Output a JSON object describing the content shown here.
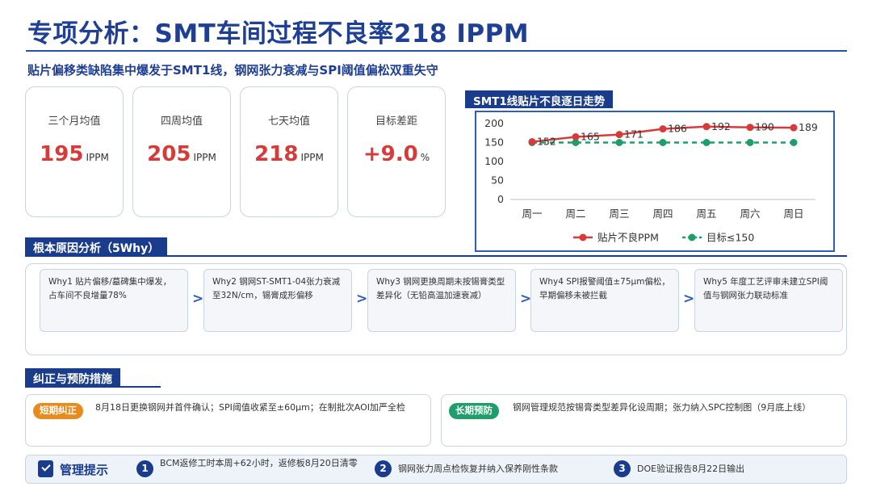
{
  "title": "专项分析：SMT车间过程不良率218 IPPM",
  "subtitle": "贴片偏移类缺陷集中爆发于SMT1线，钢网张力衰减与SPI阈值偏松双重失守",
  "kpis": [
    {
      "label": "三个月均值",
      "value": "195",
      "unit": "IPPM"
    },
    {
      "label": "四周均值",
      "value": "205",
      "unit": "IPPM"
    },
    {
      "label": "七天均值",
      "value": "218",
      "unit": "IPPM"
    },
    {
      "label": "目标差距",
      "value": "+9.0",
      "unit": "%"
    }
  ],
  "chart_tag": "SMT1线贴片不良逐日走势",
  "chart_data": {
    "type": "line",
    "categories": [
      "周一",
      "周二",
      "周三",
      "周四",
      "周五",
      "周六",
      "周日"
    ],
    "series": [
      {
        "name": "贴片不良PPM",
        "values": [
          152,
          165,
          171,
          186,
          192,
          190,
          189
        ],
        "color": "#d83a3a"
      },
      {
        "name": "目标≤150",
        "values": [
          150,
          150,
          150,
          150,
          150,
          150,
          150
        ],
        "color": "#1e9e6b",
        "dashed": true
      }
    ],
    "ylim": [
      0,
      200
    ],
    "yticks": [
      0,
      50,
      100,
      150,
      200
    ],
    "legend": "bottom",
    "grid": false
  },
  "why": {
    "tag": "根本原因分析（5Why）",
    "arrow": ">",
    "items": [
      "Why1 贴片偏移/墓碑集中爆发，占车间不良增量78%",
      "Why2 钢网ST-SMT1-04张力衰减至32N/cm，锡膏成形偏移",
      "Why3 钢网更换周期未按锡膏类型差异化（无铅高温加速衰减）",
      "Why4 SPI报警阈值±75μm偏松，早期偏移未被拦截",
      "Why5 年度工艺评审未建立SPI阈值与钢网张力联动标准"
    ]
  },
  "capa": {
    "tag": "纠正与预防措施",
    "short": {
      "badge": "短期纠正",
      "text": "8月18日更换钢网并首件确认；SPI阈值收紧至±60μm；在制批次AOI加严全检",
      "color": "#e98a1d"
    },
    "long": {
      "badge": "长期预防",
      "text": "钢网管理规范按锡膏类型差异化设周期；张力纳入SPC控制图（9月底上线）",
      "color": "#1e9e6b"
    }
  },
  "mgmt": {
    "title": "管理提示",
    "items": [
      {
        "num": "1",
        "text": "BCM返修工时本周+62小时，返修板8月20日清零"
      },
      {
        "num": "2",
        "text": "钢网张力周点检恢复并纳入保养刚性条款"
      },
      {
        "num": "3",
        "text": "DOE验证报告8月22日输出"
      }
    ]
  }
}
